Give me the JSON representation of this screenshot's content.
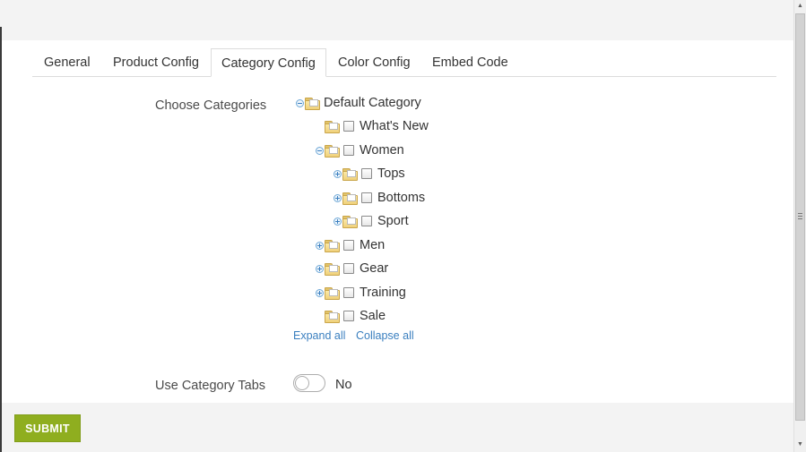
{
  "tabs": [
    {
      "label": "General",
      "active": false
    },
    {
      "label": "Product Config",
      "active": false
    },
    {
      "label": "Category Config",
      "active": true
    },
    {
      "label": "Color Config",
      "active": false
    },
    {
      "label": "Embed Code",
      "active": false
    }
  ],
  "categories": {
    "field_label": "Choose Categories",
    "tree": [
      {
        "label": "Default Category",
        "toggle": "collapse",
        "checkbox": false,
        "icon": "folder-icon",
        "depth": 0
      },
      {
        "label": "What's New",
        "toggle": "none",
        "checkbox": true,
        "checked": false,
        "icon": "folder-icon",
        "depth": 1
      },
      {
        "label": "Women",
        "toggle": "collapse",
        "checkbox": true,
        "checked": false,
        "icon": "folder-icon",
        "depth": 1
      },
      {
        "label": "Tops",
        "toggle": "expand",
        "checkbox": true,
        "checked": false,
        "icon": "folder-icon",
        "depth": 2
      },
      {
        "label": "Bottoms",
        "toggle": "expand",
        "checkbox": true,
        "checked": false,
        "icon": "folder-icon",
        "depth": 2
      },
      {
        "label": "Sport",
        "toggle": "expand",
        "checkbox": true,
        "checked": false,
        "icon": "folder-icon",
        "depth": 2
      },
      {
        "label": "Men",
        "toggle": "expand",
        "checkbox": true,
        "checked": false,
        "icon": "folder-icon",
        "depth": 1
      },
      {
        "label": "Gear",
        "toggle": "expand",
        "checkbox": true,
        "checked": false,
        "icon": "folder-icon",
        "depth": 1
      },
      {
        "label": "Training",
        "toggle": "expand",
        "checkbox": true,
        "checked": false,
        "icon": "folder-icon",
        "depth": 1
      },
      {
        "label": "Sale",
        "toggle": "none",
        "checkbox": true,
        "checked": false,
        "icon": "folder-icon",
        "depth": 1
      }
    ],
    "expand_all": "Expand all",
    "collapse_all": "Collapse all"
  },
  "category_tabs": {
    "field_label": "Use Category Tabs",
    "value": "No",
    "enabled": false
  },
  "submit_label": "SUBMIT",
  "colors": {
    "submit_bg": "#8fae1f",
    "link": "#3a7fbf",
    "panel_bg": "#ffffff",
    "page_bg": "#f3f3f3"
  }
}
